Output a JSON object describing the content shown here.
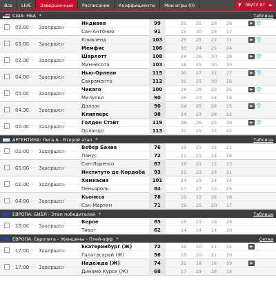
{
  "tabs": [
    {
      "label": "Все",
      "active": false
    },
    {
      "label": "LIVE",
      "active": false
    },
    {
      "label": "Завершенные",
      "active": true
    },
    {
      "label": "Расписание",
      "active": false
    },
    {
      "label": "Коэффициенты",
      "active": false
    },
    {
      "label": "Мои игры (0)",
      "active": false
    }
  ],
  "date": "08/03 Вт",
  "leagues": [
    {
      "title": "США: НБА",
      "flag": "us",
      "link": "Таблица",
      "matches": [
        {
          "time": "03:00",
          "status": "Завершен",
          "home": "Индиана",
          "away": "Сан-Антонио",
          "home_score": "99",
          "away_score": "91",
          "home_q": [
            "25",
            "25",
            "28",
            "26"
          ],
          "away_q": [
            "15",
            "30",
            "29",
            "17"
          ],
          "winner": "home"
        },
        {
          "time": "03:00",
          "status": "Завершен",
          "home": "Кливленд",
          "away": "Мемфис",
          "home_score": "103",
          "away_score": "106",
          "home_q": [
            "25",
            "25",
            "22",
            "31"
          ],
          "away_q": [
            "33",
            "24",
            "25",
            "24"
          ],
          "winner": "away"
        },
        {
          "time": "03:30",
          "status": "Завершен",
          "home": "Шарлотт",
          "away": "Миннесота",
          "home_score": "108",
          "away_score": "103",
          "home_q": [
            "24",
            "26",
            "30",
            "28"
          ],
          "away_q": [
            "18",
            "25",
            "30",
            "30"
          ],
          "winner": "home"
        },
        {
          "time": "04:00",
          "status": "Завершен",
          "home": "Нью-Орлеан",
          "away": "Сакраменто",
          "home_score": "115",
          "away_score": "112",
          "home_q": [
            "30",
            "27",
            "31",
            "27"
          ],
          "away_q": [
            "31",
            "25",
            "30",
            "26"
          ],
          "winner": "home"
        },
        {
          "time": "04:00",
          "status": "Завершен",
          "home": "Чикаго",
          "away": "Милуоки",
          "home_score": "100",
          "away_score": "90",
          "home_q": [
            "24",
            "28",
            "23",
            "25"
          ],
          "away_q": [
            "25",
            "23",
            "24",
            "18"
          ],
          "winner": "home"
        },
        {
          "time": "04:30",
          "status": "Завершен",
          "home": "Даллас",
          "away": "Клипперс",
          "home_score": "90",
          "away_score": "98",
          "home_q": [
            "24",
            "25",
            "26",
            "15"
          ],
          "away_q": [
            "24",
            "23",
            "29",
            "22"
          ],
          "winner": "away"
        },
        {
          "time": "06:30",
          "status": "Завершен",
          "home": "Голден Стэйт",
          "away": "Орландо",
          "home_score": "119",
          "away_score": "113",
          "home_q": [
            "38",
            "26",
            "25",
            "30"
          ],
          "away_q": [
            "31",
            "25",
            "15",
            "42"
          ],
          "winner": "home"
        }
      ]
    },
    {
      "title": "АРГЕНТИНА: Лига А - Второй этап",
      "flag": "ar",
      "link": "Таблица",
      "matches": [
        {
          "time": "03:00",
          "status": "Завершен",
          "home": "Вебер Бахия",
          "away": "Ланус",
          "home_score": "76",
          "away_score": "72",
          "home_q": [
            "19",
            "21",
            "15",
            "21"
          ],
          "away_q": [
            "21",
            "21",
            "14",
            "16"
          ],
          "winner": "home"
        },
        {
          "time": "03:00",
          "status": "Завершен",
          "home": "Сан-Лоренсо",
          "away": "Институто де Кордоба",
          "home_score": "87",
          "away_score": "93",
          "home_q": [
            "28",
            "21",
            "15",
            "23"
          ],
          "away_q": [
            "21",
            "23",
            "28",
            "21"
          ],
          "winner": "away"
        },
        {
          "time": "03:30",
          "status": "Завершен",
          "home": "Химнасия",
          "away": "Пеньяроль",
          "home_score": "101",
          "away_score": "84",
          "home_q": [
            "24",
            "29",
            "24",
            "24"
          ],
          "away_q": [
            "17",
            "27",
            "15",
            "25"
          ],
          "winner": "home"
        },
        {
          "time": "04:00",
          "status": "Завершен",
          "home": "Кьонкса",
          "away": "Сан-Мартин",
          "home_score": "78",
          "away_score": "71",
          "home_q": [
            "19",
            "15",
            "26",
            "18"
          ],
          "away_q": [
            "19",
            "15",
            "20",
            "17"
          ],
          "winner": "home"
        }
      ]
    },
    {
      "title": "ЕВРОПА: БИБЛ - Этап победителей",
      "flag": "eu",
      "link": "Таблица",
      "matches": [
        {
          "time": "19:00",
          "status": "Завершен",
          "home": "Берое",
          "away": "Тиват",
          "home_score": "85",
          "away_score": "62",
          "home_q": [
            "15",
            "23",
            "18",
            "29"
          ],
          "away_q": [
            "14",
            "14",
            "14",
            "20"
          ],
          "winner": "home"
        }
      ]
    },
    {
      "title": "ЕВРОПА: Евролига - Женщины - Плей-офф",
      "flag": "eu",
      "link": "Сетка",
      "matches": [
        {
          "time": "17:00",
          "status": "Завершен",
          "home": "Екатеринбург (Ж)",
          "away": "Галатасарай (Ж)",
          "home_score": "72",
          "away_score": "56",
          "home_q": [
            "16",
            "20",
            "21",
            "15"
          ],
          "away_q": [
            "15",
            "10",
            "21",
            "10"
          ],
          "winner": "home"
        },
        {
          "time": "17:00",
          "status": "Завершен",
          "home": "Надежда (Ж)",
          "away": "Динамо Курск (Ж)",
          "home_score": "74",
          "away_score": "68",
          "home_q": [
            "21",
            "18",
            "16",
            "19"
          ],
          "away_q": [
            "17",
            "19",
            "18",
            "14"
          ],
          "winner": "home"
        }
      ]
    }
  ],
  "icons": {
    "checkbox": "checkbox-icon",
    "tv": "tv-icon",
    "shirt": "lineup-shirt-icon",
    "pin": "pin-icon",
    "arrow": "triangle-down-icon"
  }
}
